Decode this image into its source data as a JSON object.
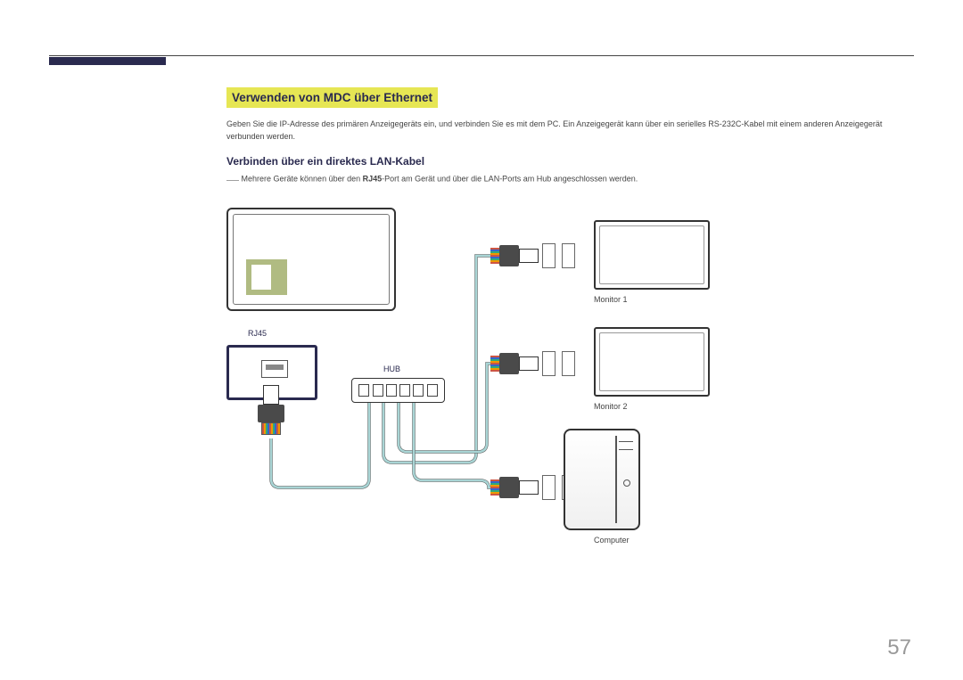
{
  "section_title": "Verwenden von MDC über Ethernet",
  "intro": "Geben Sie die IP-Adresse des primären Anzeigegeräts ein, und verbinden Sie es mit dem PC. Ein Anzeigegerät kann über ein serielles RS-232C-Kabel mit einem anderen Anzeigegerät verbunden werden.",
  "sub_heading": "Verbinden über ein direktes LAN-Kabel",
  "note_prefix": "Mehrere Geräte können über den ",
  "note_bold": "RJ45",
  "note_suffix": "-Port am Gerät und über die LAN-Ports am Hub angeschlossen werden.",
  "labels": {
    "rj45": "RJ45",
    "hub": "HUB",
    "monitor1": "Monitor 1",
    "monitor2": "Monitor 2",
    "computer": "Computer"
  },
  "page_number": "57"
}
